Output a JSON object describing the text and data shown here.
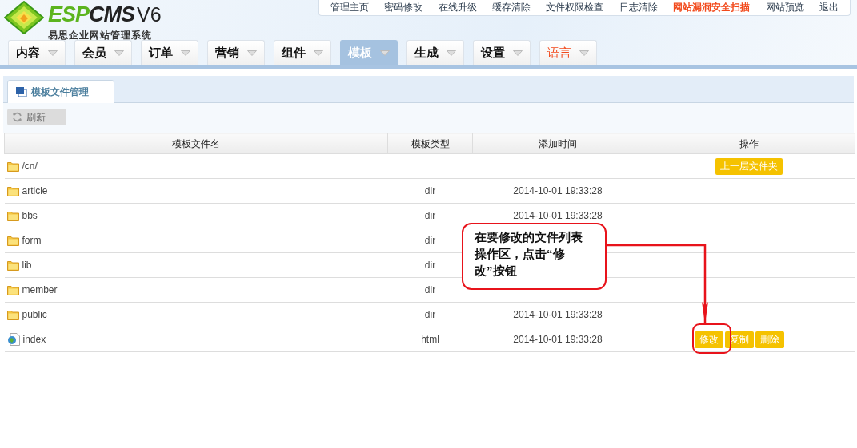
{
  "logo": {
    "brand_green": "ESP",
    "brand_dark": "CMS",
    "version": "V6",
    "subtitle": "易思企业网站管理系统"
  },
  "top_links": [
    {
      "label": "管理主页",
      "highlight": false
    },
    {
      "label": "密码修改",
      "highlight": false
    },
    {
      "label": "在线升级",
      "highlight": false
    },
    {
      "label": "缓存清除",
      "highlight": false
    },
    {
      "label": "文件权限检查",
      "highlight": false
    },
    {
      "label": "日志清除",
      "highlight": false
    },
    {
      "label": "网站漏洞安全扫描",
      "highlight": true
    },
    {
      "label": "网站预览",
      "highlight": false
    },
    {
      "label": "退出",
      "highlight": false
    }
  ],
  "menu": [
    {
      "label": "内容",
      "selected": false,
      "highlight": false
    },
    {
      "label": "会员",
      "selected": false,
      "highlight": false
    },
    {
      "label": "订单",
      "selected": false,
      "highlight": false
    },
    {
      "label": "营销",
      "selected": false,
      "highlight": false
    },
    {
      "label": "组件",
      "selected": false,
      "highlight": false
    },
    {
      "label": "模板",
      "selected": true,
      "highlight": false
    },
    {
      "label": "生成",
      "selected": false,
      "highlight": false
    },
    {
      "label": "设置",
      "selected": false,
      "highlight": false
    },
    {
      "label": "语言",
      "selected": false,
      "highlight": true
    }
  ],
  "panel_tab": {
    "label": "模板文件管理"
  },
  "toolbar": {
    "refresh": "刷新"
  },
  "table": {
    "columns": [
      "模板文件名",
      "模板类型",
      "添加时间",
      "操作"
    ],
    "rows": [
      {
        "kind": "folder",
        "name": "/cn/",
        "actions": [
          "上一层文件夹"
        ]
      },
      {
        "kind": "folder",
        "name": "article",
        "type": "dir",
        "time": "2014-10-01 19:33:28"
      },
      {
        "kind": "folder",
        "name": "bbs",
        "type": "dir",
        "time": "2014-10-01 19:33:28"
      },
      {
        "kind": "folder",
        "name": "form",
        "type": "dir"
      },
      {
        "kind": "folder",
        "name": "lib",
        "type": "dir"
      },
      {
        "kind": "folder",
        "name": "member",
        "type": "dir"
      },
      {
        "kind": "folder",
        "name": "public",
        "type": "dir",
        "time": "2014-10-01 19:33:28"
      },
      {
        "kind": "file",
        "name": "index",
        "type": "html",
        "time": "2014-10-01 19:33:28",
        "actions": [
          "修改",
          "复制",
          "删除"
        ]
      }
    ]
  },
  "callout": {
    "text": "在要修改的文件列表操作区，点击“修改”按钮"
  }
}
